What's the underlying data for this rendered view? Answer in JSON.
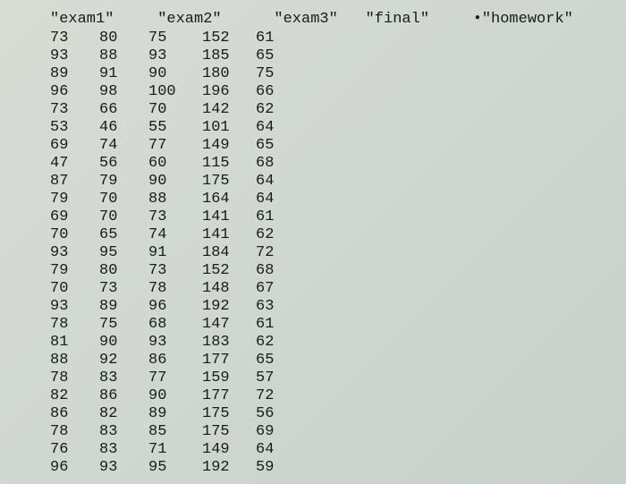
{
  "headers": {
    "exam1": "\"exam1\"",
    "exam2": "\"exam2\"",
    "exam3": "\"exam3\"",
    "final": "\"final\"",
    "homework": "\"homework\""
  },
  "rows": [
    {
      "c0": "73",
      "c1": "80",
      "c2": "75",
      "c3": "152",
      "c4": "61"
    },
    {
      "c0": "93",
      "c1": "88",
      "c2": "93",
      "c3": "185",
      "c4": "65"
    },
    {
      "c0": "89",
      "c1": "91",
      "c2": "90",
      "c3": "180",
      "c4": "75"
    },
    {
      "c0": "96",
      "c1": "98",
      "c2": "100",
      "c3": "196",
      "c4": "66"
    },
    {
      "c0": "73",
      "c1": "66",
      "c2": "70",
      "c3": "142",
      "c4": "62"
    },
    {
      "c0": "53",
      "c1": "46",
      "c2": "55",
      "c3": "101",
      "c4": "64"
    },
    {
      "c0": "69",
      "c1": "74",
      "c2": "77",
      "c3": "149",
      "c4": "65"
    },
    {
      "c0": "47",
      "c1": "56",
      "c2": "60",
      "c3": "115",
      "c4": "68"
    },
    {
      "c0": "87",
      "c1": "79",
      "c2": "90",
      "c3": "175",
      "c4": "64"
    },
    {
      "c0": "79",
      "c1": "70",
      "c2": "88",
      "c3": "164",
      "c4": "64"
    },
    {
      "c0": "69",
      "c1": "70",
      "c2": "73",
      "c3": "141",
      "c4": "61"
    },
    {
      "c0": "70",
      "c1": "65",
      "c2": "74",
      "c3": "141",
      "c4": "62"
    },
    {
      "c0": "93",
      "c1": "95",
      "c2": "91",
      "c3": "184",
      "c4": "72"
    },
    {
      "c0": "79",
      "c1": "80",
      "c2": "73",
      "c3": "152",
      "c4": "68"
    },
    {
      "c0": "70",
      "c1": "73",
      "c2": "78",
      "c3": "148",
      "c4": "67"
    },
    {
      "c0": "93",
      "c1": "89",
      "c2": "96",
      "c3": "192",
      "c4": "63"
    },
    {
      "c0": "78",
      "c1": "75",
      "c2": "68",
      "c3": "147",
      "c4": "61"
    },
    {
      "c0": "81",
      "c1": "90",
      "c2": "93",
      "c3": "183",
      "c4": "62"
    },
    {
      "c0": "88",
      "c1": "92",
      "c2": "86",
      "c3": "177",
      "c4": "65"
    },
    {
      "c0": "78",
      "c1": "83",
      "c2": "77",
      "c3": "159",
      "c4": "57"
    },
    {
      "c0": "82",
      "c1": "86",
      "c2": "90",
      "c3": "177",
      "c4": "72"
    },
    {
      "c0": "86",
      "c1": "82",
      "c2": "89",
      "c3": "175",
      "c4": "56"
    },
    {
      "c0": "78",
      "c1": "83",
      "c2": "85",
      "c3": "175",
      "c4": "69"
    },
    {
      "c0": "76",
      "c1": "83",
      "c2": "71",
      "c3": "149",
      "c4": "64"
    },
    {
      "c0": "96",
      "c1": "93",
      "c2": "95",
      "c3": "192",
      "c4": "59"
    }
  ]
}
